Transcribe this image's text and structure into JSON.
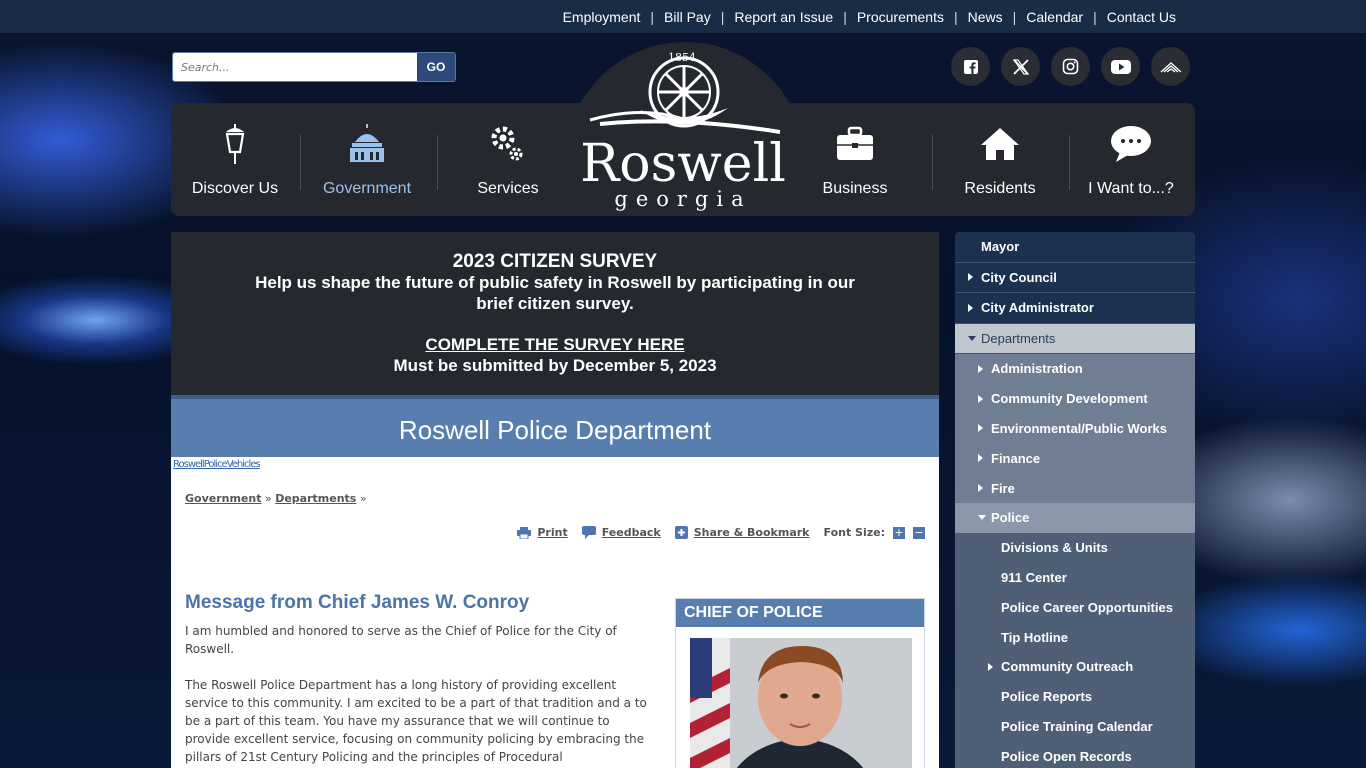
{
  "top_links": [
    "Employment",
    "Bill Pay",
    "Report an Issue",
    "Procurements",
    "News",
    "Calendar",
    "Contact Us"
  ],
  "search": {
    "placeholder": "Search...",
    "button": "GO"
  },
  "social": [
    "facebook-icon",
    "x-icon",
    "instagram-icon",
    "youtube-icon",
    "rss-icon"
  ],
  "logo": {
    "city": "Roswell",
    "state": "georgia",
    "year": "1854"
  },
  "nav": {
    "discover": "Discover Us",
    "government": "Government",
    "services": "Services",
    "business": "Business",
    "residents": "Residents",
    "iwant": "I Want to...?"
  },
  "survey": {
    "title": "2023 CITIZEN SURVEY",
    "text": "Help us shape the future of public safety in Roswell by participating in our brief citizen survey.",
    "link": "COMPLETE THE SURVEY HERE",
    "deadline": "Must be submitted by December 5, 2023"
  },
  "dept_title": "Roswell Police Department",
  "broken_image_alt": "RoswellPoliceVehicles",
  "breadcrumb": {
    "first": "Government",
    "second": "Departments",
    "sep": "»"
  },
  "tools": {
    "print": "Print",
    "feedback": "Feedback",
    "share": "Share & Bookmark",
    "font_size": "Font Size:",
    "plus": "+",
    "minus": "−"
  },
  "message": {
    "title": "Message from Chief James W. Conroy",
    "p1": "I am humbled and honored to serve as the Chief of Police for the City of Roswell.",
    "p2": "The Roswell Police Department has a long history of providing excellent service to this community. I am excited to be a part of that tradition and a to be a part of this team. You have my assurance that we will continue to provide excellent service, focusing on community policing by embracing the pillars of 21st Century Policing and the principles of Procedural"
  },
  "chief_box": {
    "heading": "CHIEF OF POLICE"
  },
  "sidebar": [
    {
      "label": "Mayor",
      "level": 0
    },
    {
      "label": "City Council",
      "level": 0,
      "arrow": "right"
    },
    {
      "label": "City Administrator",
      "level": 0,
      "arrow": "right"
    },
    {
      "label": "Departments",
      "level": 0,
      "arrow": "down",
      "open": true
    },
    {
      "label": "Administration",
      "level": 1,
      "arrow": "right"
    },
    {
      "label": "Community Development",
      "level": 1,
      "arrow": "right"
    },
    {
      "label": "Environmental/Public Works",
      "level": 1,
      "arrow": "right"
    },
    {
      "label": "Finance",
      "level": 1,
      "arrow": "right"
    },
    {
      "label": "Fire",
      "level": 1,
      "arrow": "right"
    },
    {
      "label": "Police",
      "level": 1,
      "arrow": "down",
      "open": true
    },
    {
      "label": "Divisions & Units",
      "level": 2
    },
    {
      "label": "911 Center",
      "level": 2
    },
    {
      "label": "Police Career Opportunities",
      "level": 2
    },
    {
      "label": "Tip Hotline",
      "level": 2
    },
    {
      "label": "Community Outreach",
      "level": 2,
      "arrow": "right"
    },
    {
      "label": "Police Reports",
      "level": 2
    },
    {
      "label": "Police Training Calendar",
      "level": 2
    },
    {
      "label": "Police Open Records",
      "level": 2
    }
  ]
}
